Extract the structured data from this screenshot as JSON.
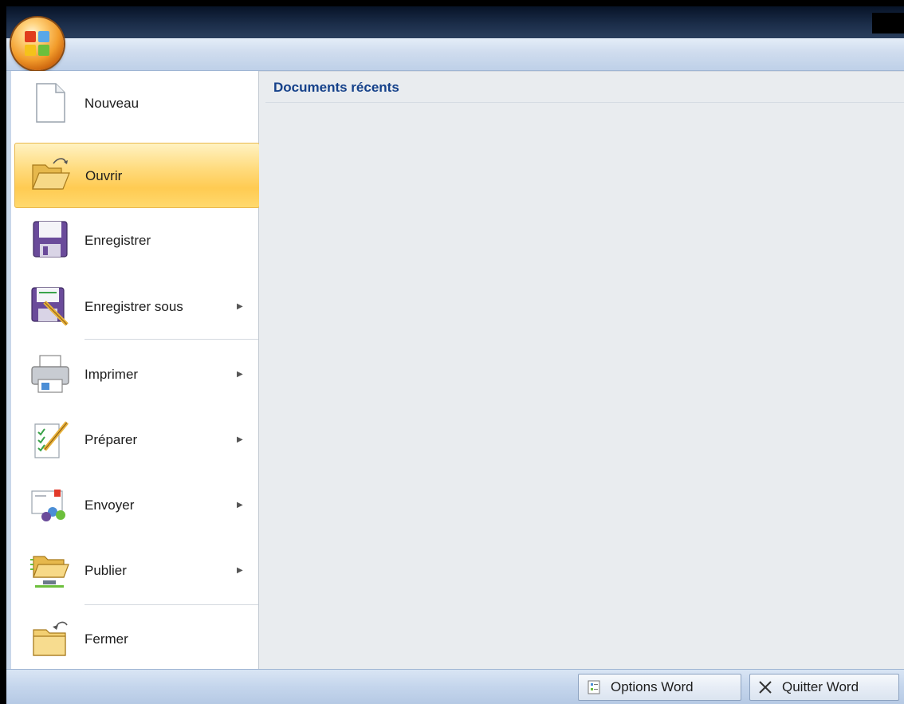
{
  "menu": {
    "items": [
      {
        "label": "Nouveau",
        "icon": "new-document-icon",
        "submenu": false
      },
      {
        "label": "Ouvrir",
        "icon": "open-folder-icon",
        "submenu": false,
        "highlighted": true
      },
      {
        "label": "Enregistrer",
        "icon": "save-floppy-icon",
        "submenu": false
      },
      {
        "label": "Enregistrer sous",
        "icon": "save-as-icon",
        "submenu": true
      },
      {
        "label": "Imprimer",
        "icon": "printer-icon",
        "submenu": true
      },
      {
        "label": "Préparer",
        "icon": "prepare-document-icon",
        "submenu": true
      },
      {
        "label": "Envoyer",
        "icon": "send-icon",
        "submenu": true
      },
      {
        "label": "Publier",
        "icon": "publish-folder-icon",
        "submenu": true
      },
      {
        "label": "Fermer",
        "icon": "close-folder-icon",
        "submenu": false
      }
    ],
    "submenu_arrow": "▶"
  },
  "recent": {
    "title": "Documents récents"
  },
  "footer": {
    "options_label": "Options Word",
    "options_icon": "options-icon",
    "quit_label": "Quitter Word",
    "quit_icon": "close-x-icon"
  },
  "colors": {
    "highlight": "#ffcb52",
    "recent_title": "#15418a",
    "office_orb": "#f29c2b"
  }
}
